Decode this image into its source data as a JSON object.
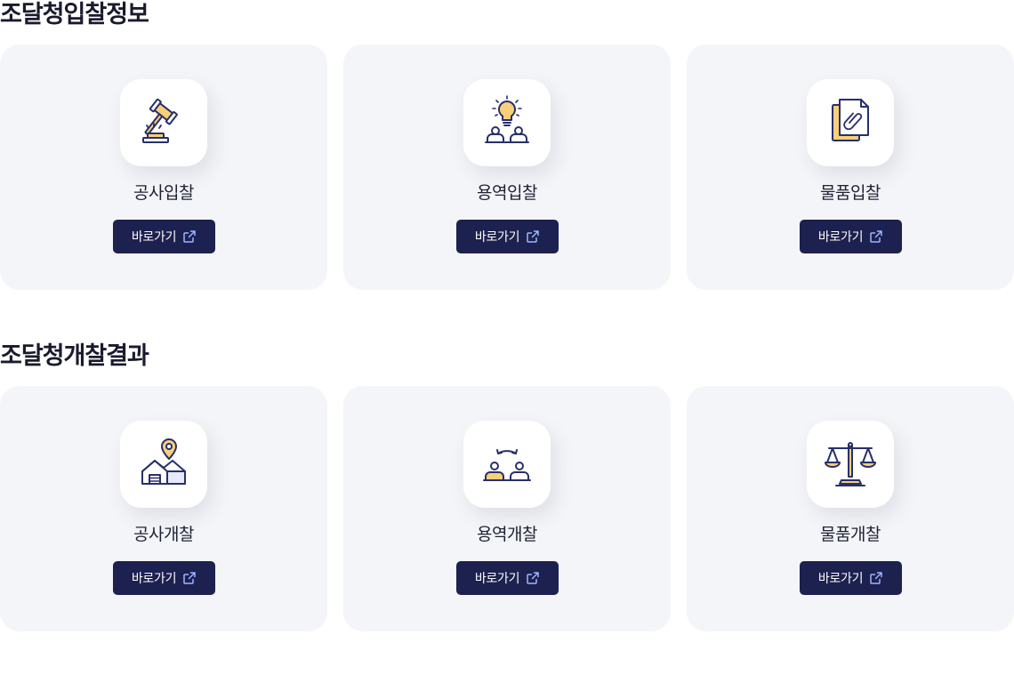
{
  "sections": [
    {
      "title": "조달청입찰정보",
      "cards": [
        {
          "label": "공사입찰",
          "button": "바로가기",
          "icon": "gavel-icon"
        },
        {
          "label": "용역입찰",
          "button": "바로가기",
          "icon": "idea-team-icon"
        },
        {
          "label": "물품입찰",
          "button": "바로가기",
          "icon": "documents-clip-icon"
        }
      ]
    },
    {
      "title": "조달청개찰결과",
      "cards": [
        {
          "label": "공사개찰",
          "button": "바로가기",
          "icon": "building-location-icon"
        },
        {
          "label": "용역개찰",
          "button": "바로가기",
          "icon": "people-exchange-icon"
        },
        {
          "label": "물품개찰",
          "button": "바로가기",
          "icon": "balance-scale-icon"
        }
      ]
    }
  ],
  "colors": {
    "accent_yellow": "#f9cf7a",
    "icon_navy": "#27306b",
    "button_bg": "#1c2150",
    "card_bg": "#f4f5f8",
    "external_icon": "#9fb6ff"
  }
}
